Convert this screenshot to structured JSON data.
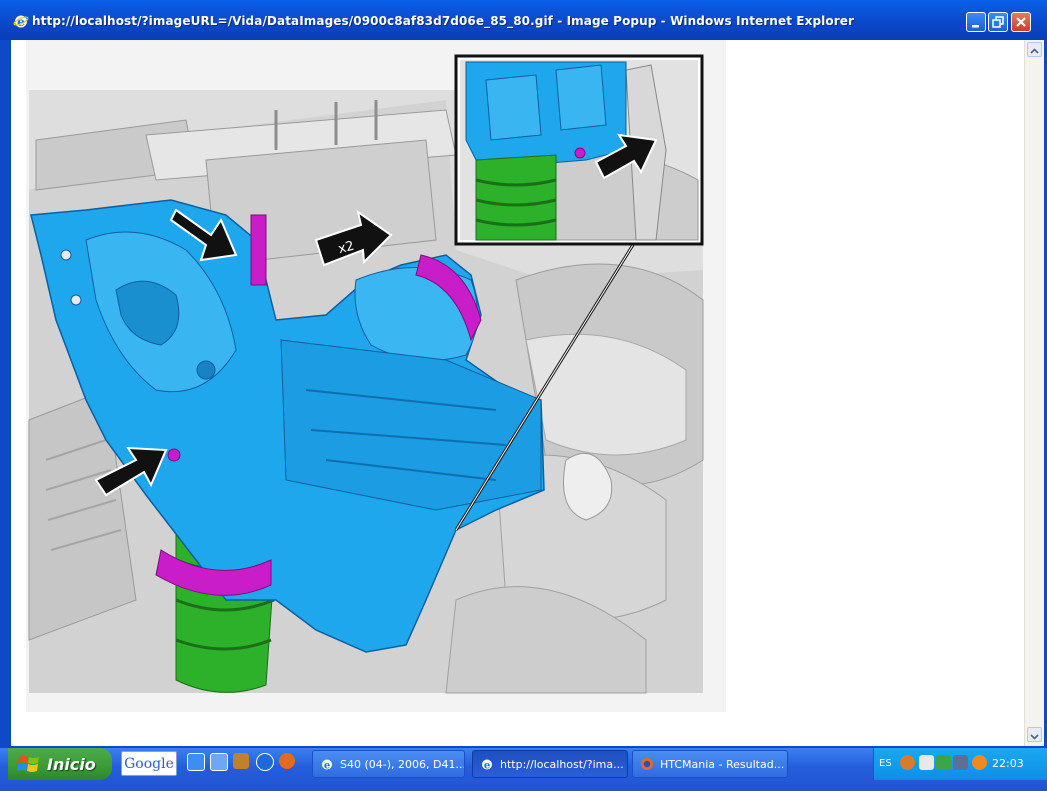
{
  "window": {
    "title": "http://localhost/?imageURL=/Vida/DataImages/0900c8af83d7d06e_85_80.gif - Image Popup - Windows Internet Explorer"
  },
  "diagram": {
    "callout_label": "x2"
  },
  "taskbar": {
    "start_label": "Inicio",
    "google_label": "Google",
    "tasks": [
      {
        "label": "S40 (04-), 2006, D41..."
      },
      {
        "label": "http://localhost/?ima..."
      },
      {
        "label": "HTCMania - Resultad..."
      }
    ],
    "language": "ES",
    "clock": "22:03"
  },
  "colors": {
    "titlebar": "#0b47c9",
    "turbo_blue": "#1fa7ee",
    "hose_green": "#2db02a",
    "clamp_magenta": "#c81dc8",
    "engine_gray": "#d9d9d9"
  }
}
